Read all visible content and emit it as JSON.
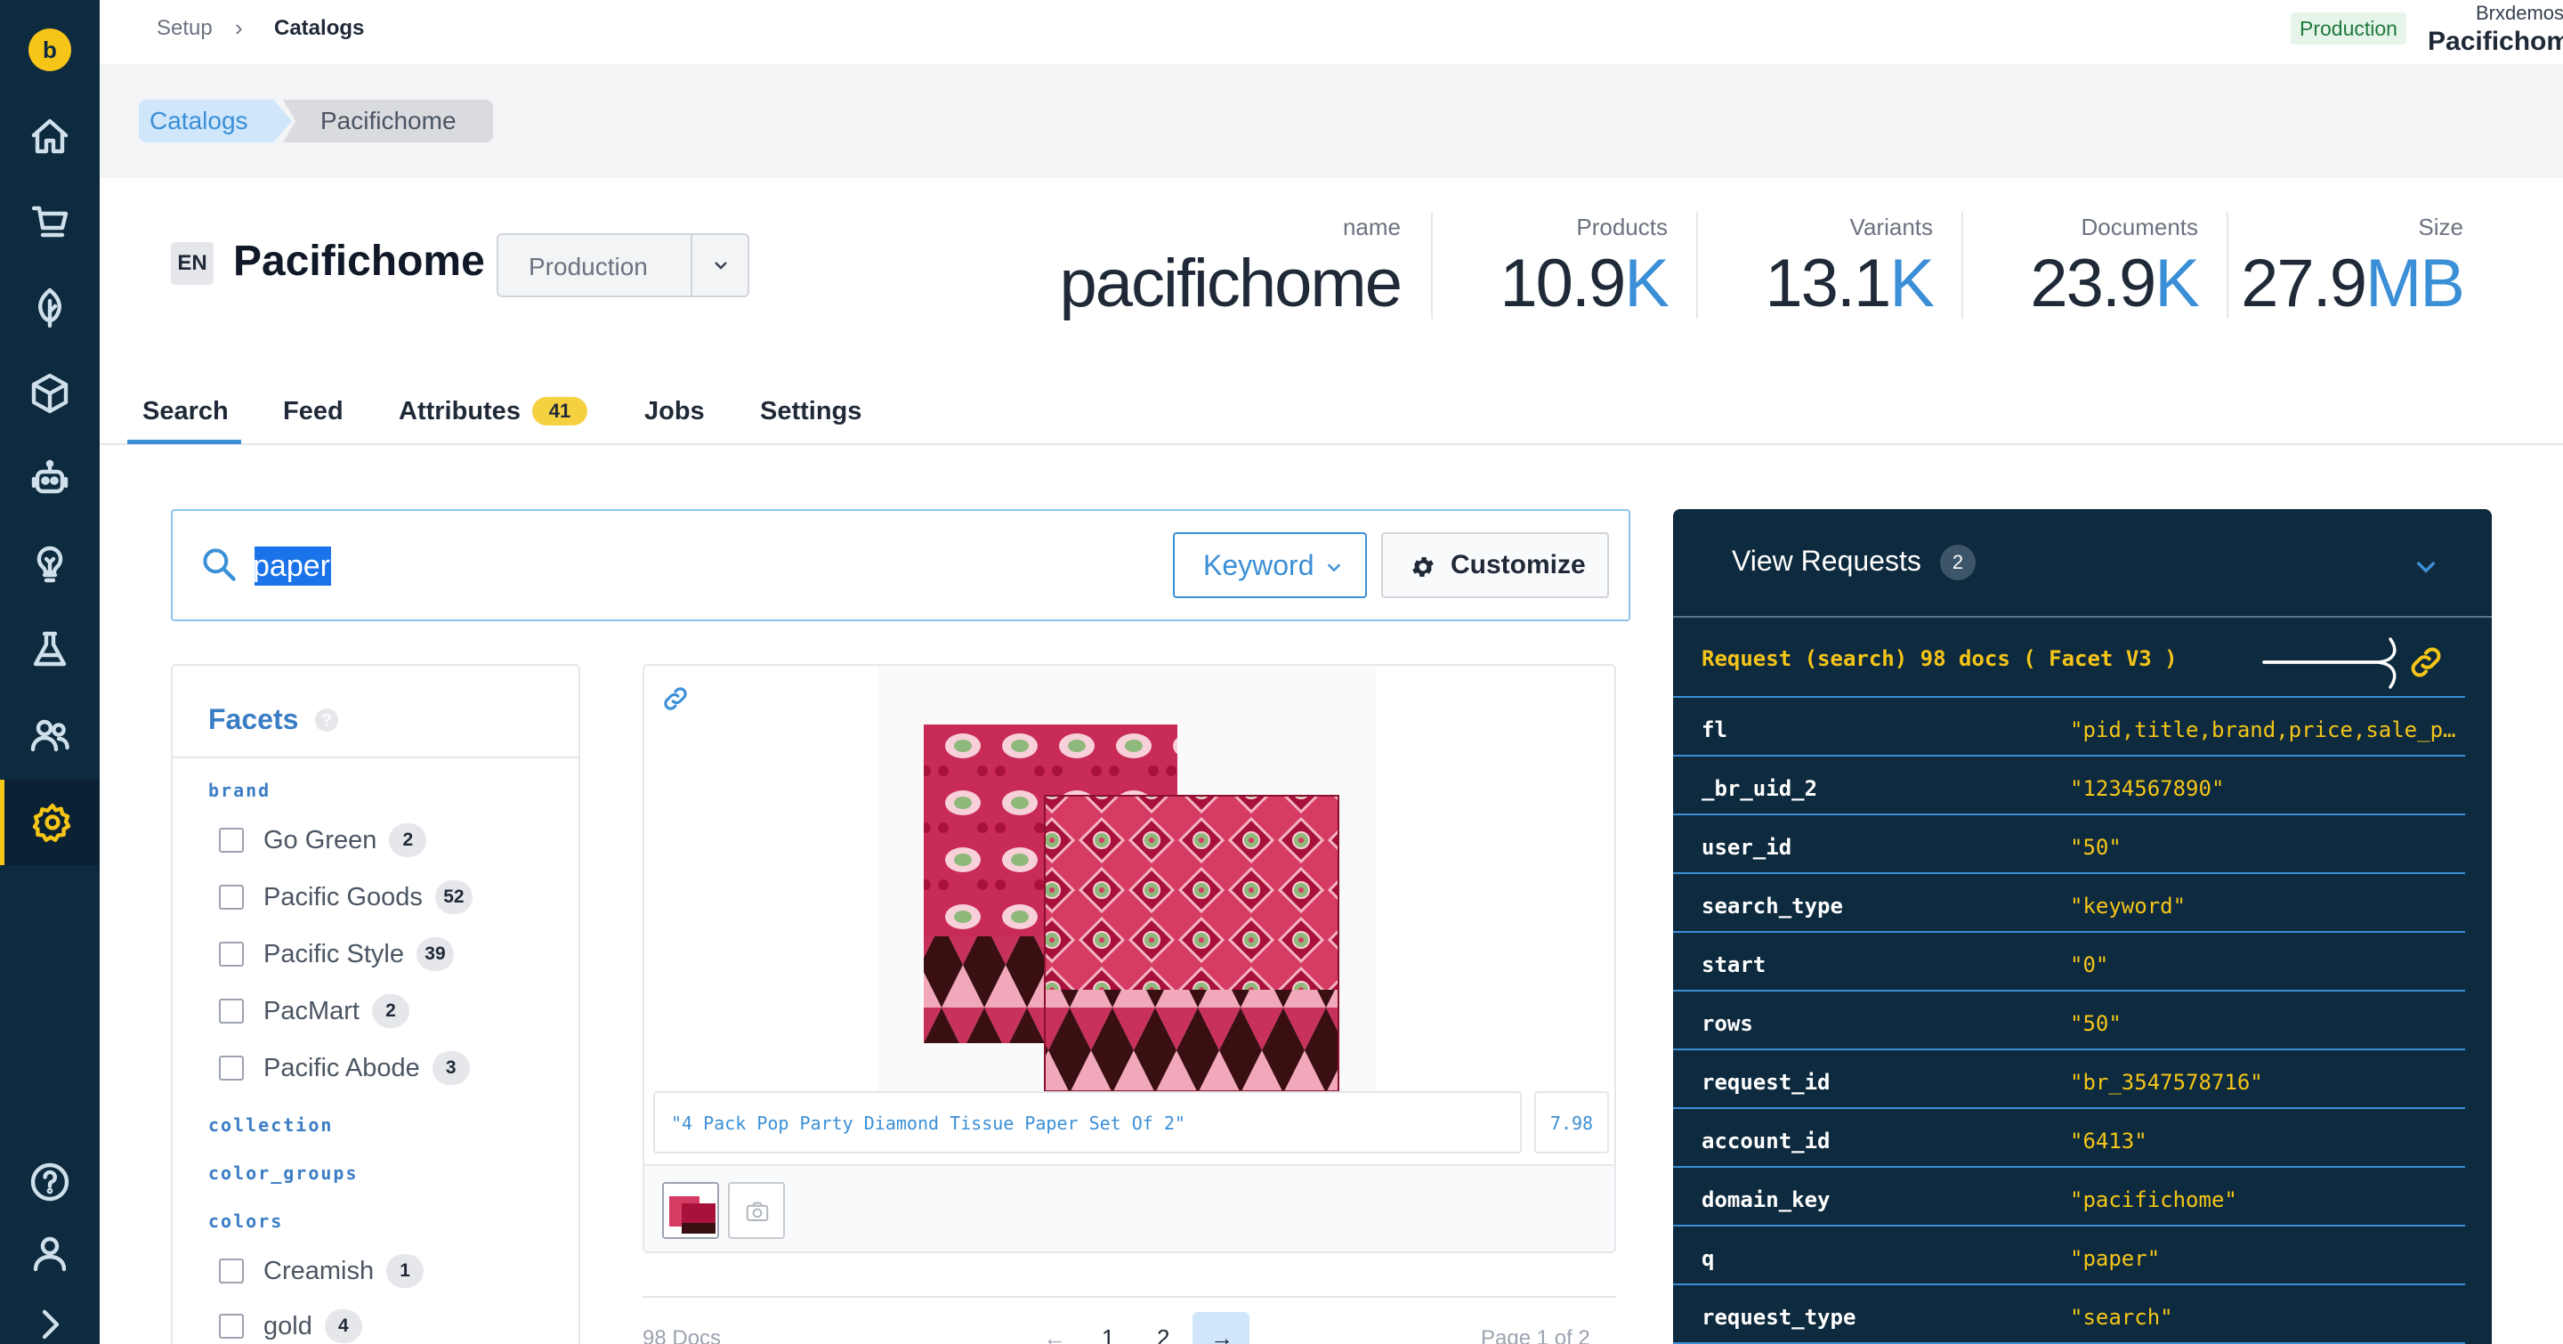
{
  "topbar": {
    "crumb_setup": "Setup",
    "crumb_sep": "›",
    "crumb_catalogs": "Catalogs",
    "env_badge": "Production",
    "account_small": "Brxdemos",
    "account_big": "Pacifichome"
  },
  "breadcrumb": {
    "catalogs": "Catalogs",
    "current": "Pacifichome"
  },
  "header": {
    "lang": "EN",
    "title": "Pacifichome",
    "environment": "Production",
    "stats": [
      {
        "label": "name",
        "value": "pacifichome",
        "unit": ""
      },
      {
        "label": "Products",
        "value": "10.9",
        "unit": "K"
      },
      {
        "label": "Variants",
        "value": "13.1",
        "unit": "K"
      },
      {
        "label": "Documents",
        "value": "23.9",
        "unit": "K"
      },
      {
        "label": "Size",
        "value": "27.9",
        "unit": "MB"
      }
    ]
  },
  "tabs": [
    {
      "label": "Search"
    },
    {
      "label": "Feed"
    },
    {
      "label": "Attributes",
      "badge": "41"
    },
    {
      "label": "Jobs"
    },
    {
      "label": "Settings"
    }
  ],
  "search": {
    "query": "paper",
    "mode": "Keyword",
    "customize": "Customize"
  },
  "facets": {
    "title": "Facets",
    "help": "?",
    "groups": [
      {
        "name": "brand",
        "options": [
          {
            "label": "Go Green",
            "count": "2"
          },
          {
            "label": "Pacific Goods",
            "count": "52"
          },
          {
            "label": "Pacific Style",
            "count": "39"
          },
          {
            "label": "PacMart",
            "count": "2"
          },
          {
            "label": "Pacific Abode",
            "count": "3"
          }
        ]
      },
      {
        "name": "collection",
        "options": []
      },
      {
        "name": "color_groups",
        "options": []
      },
      {
        "name": "colors",
        "options": [
          {
            "label": "Creamish",
            "count": "1"
          },
          {
            "label": "gold",
            "count": "4"
          }
        ]
      }
    ]
  },
  "product": {
    "title": "\"4 Pack Pop Party Diamond Tissue Paper Set Of 2\"",
    "price": "7.98",
    "colors": {
      "pink": "#d63b63",
      "red": "#a8123a",
      "dark": "#3a0f12",
      "green": "#8fb97a"
    }
  },
  "pagination": {
    "docs": "98 Docs",
    "prev": "←",
    "pages": [
      "1",
      "2"
    ],
    "next": "→",
    "page_of": "Page 1 of 2"
  },
  "requests": {
    "title": "View Requests",
    "count": "2",
    "header": "Request (search) 98 docs ( Facet V3 )",
    "params": [
      {
        "key": "fl",
        "value": "\"pid,title,brand,price,sale_price,thumb_image\""
      },
      {
        "key": "_br_uid_2",
        "value": "\"1234567890\""
      },
      {
        "key": "user_id",
        "value": "\"50\""
      },
      {
        "key": "search_type",
        "value": "\"keyword\""
      },
      {
        "key": "start",
        "value": "\"0\""
      },
      {
        "key": "rows",
        "value": "\"50\""
      },
      {
        "key": "request_id",
        "value": "\"br_3547578716\""
      },
      {
        "key": "account_id",
        "value": "\"6413\""
      },
      {
        "key": "domain_key",
        "value": "\"pacifichome\""
      },
      {
        "key": "q",
        "value": "\"paper\""
      },
      {
        "key": "request_type",
        "value": "\"search\""
      }
    ]
  },
  "sidebar": {
    "logo": "b",
    "items": [
      "home-icon",
      "cart-icon",
      "leaf-icon",
      "cube-icon",
      "robot-icon",
      "lightbulb-icon",
      "flask-icon",
      "users-icon",
      "gear-icon",
      "help-icon",
      "user-icon",
      "expand-icon"
    ],
    "active": "gear-icon"
  }
}
